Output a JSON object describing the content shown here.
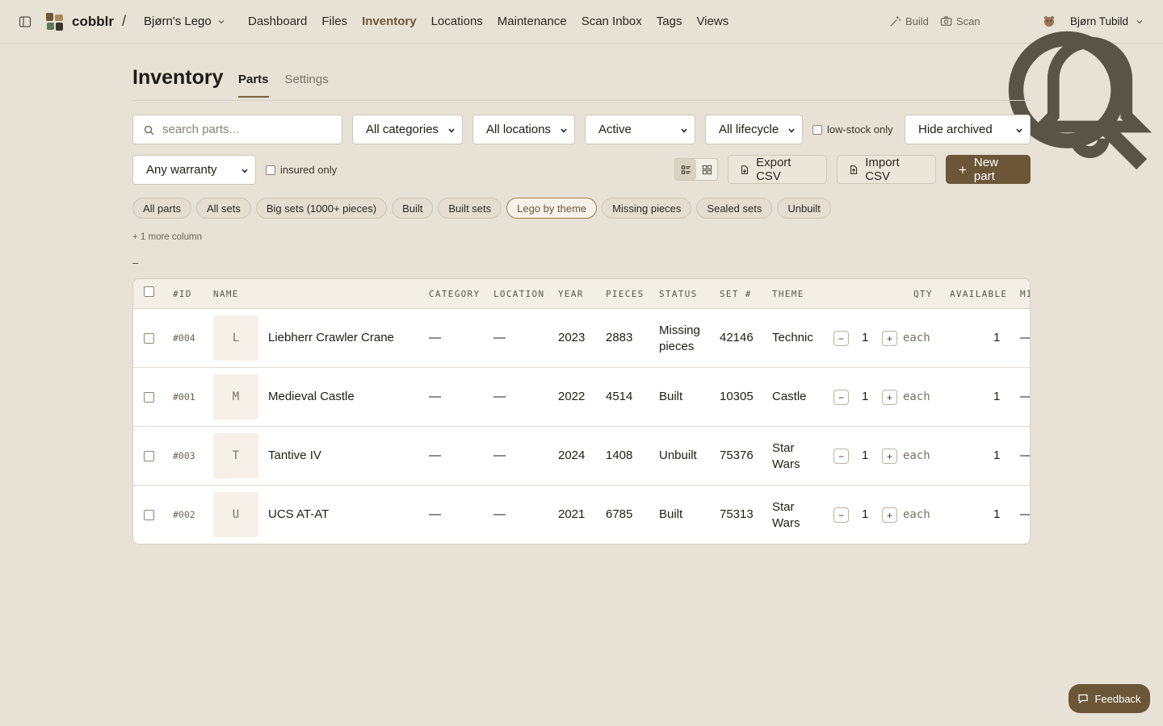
{
  "app": {
    "brand": "cobblr",
    "separator": "/",
    "workspace": "Bjørn's Lego"
  },
  "nav": {
    "items": [
      "Dashboard",
      "Files",
      "Inventory",
      "Locations",
      "Maintenance",
      "Scan Inbox",
      "Tags",
      "Views"
    ],
    "active": "Inventory"
  },
  "tools": {
    "build": "Build",
    "scan": "Scan",
    "user": "Bjørn Tubild"
  },
  "page": {
    "title": "Inventory",
    "tabs": [
      "Parts",
      "Settings"
    ],
    "active_tab": "Parts"
  },
  "filters": {
    "search_placeholder": "search parts...",
    "category": "All categories",
    "location": "All locations",
    "status": "Active",
    "lifecycle": "All lifecycle",
    "low_stock_label": "low-stock only",
    "archived": "Hide archived",
    "warranty": "Any warranty",
    "insured_label": "insured only"
  },
  "actions": {
    "export": "Export CSV",
    "import": "Import CSV",
    "new": "New part"
  },
  "views": {
    "chips": [
      "All parts",
      "All sets",
      "Big sets (1000+ pieces)",
      "Built",
      "Built sets",
      "Lego by theme",
      "Missing pieces",
      "Sealed sets",
      "Unbuilt"
    ],
    "active": "Lego by theme",
    "more_columns": "+ 1 more column",
    "marker": "–"
  },
  "table": {
    "headers": {
      "id": "#ID",
      "name": "NAME",
      "category": "CATEGORY",
      "location": "LOCATION",
      "year": "YEAR",
      "pieces": "PIECES",
      "status": "STATUS",
      "set": "SET #",
      "theme": "THEME",
      "qty": "QTY",
      "available": "AVAILABLE",
      "min": "MI"
    },
    "rows": [
      {
        "id": "#004",
        "initial": "L",
        "name": "Liebherr Crawler Crane",
        "category": "—",
        "location": "—",
        "year": "2023",
        "pieces": "2883",
        "status": "Missing pieces",
        "set": "42146",
        "theme": "Technic",
        "qty": "1",
        "unit": "each",
        "available": "1",
        "min": "—"
      },
      {
        "id": "#001",
        "initial": "M",
        "name": "Medieval Castle",
        "category": "—",
        "location": "—",
        "year": "2022",
        "pieces": "4514",
        "status": "Built",
        "set": "10305",
        "theme": "Castle",
        "qty": "1",
        "unit": "each",
        "available": "1",
        "min": "—"
      },
      {
        "id": "#003",
        "initial": "T",
        "name": "Tantive IV",
        "category": "—",
        "location": "—",
        "year": "2024",
        "pieces": "1408",
        "status": "Unbuilt",
        "set": "75376",
        "theme": "Star Wars",
        "qty": "1",
        "unit": "each",
        "available": "1",
        "min": "—"
      },
      {
        "id": "#002",
        "initial": "U",
        "name": "UCS AT-AT",
        "category": "—",
        "location": "—",
        "year": "2021",
        "pieces": "6785",
        "status": "Built",
        "set": "75313",
        "theme": "Star Wars",
        "qty": "1",
        "unit": "each",
        "available": "1",
        "min": "—"
      }
    ],
    "stepper": {
      "minus": "−",
      "plus": "+"
    }
  },
  "feedback": "Feedback",
  "colors": {
    "accent": "#6b5738",
    "background": "#e8e2d6",
    "surface": "#ffffff"
  }
}
